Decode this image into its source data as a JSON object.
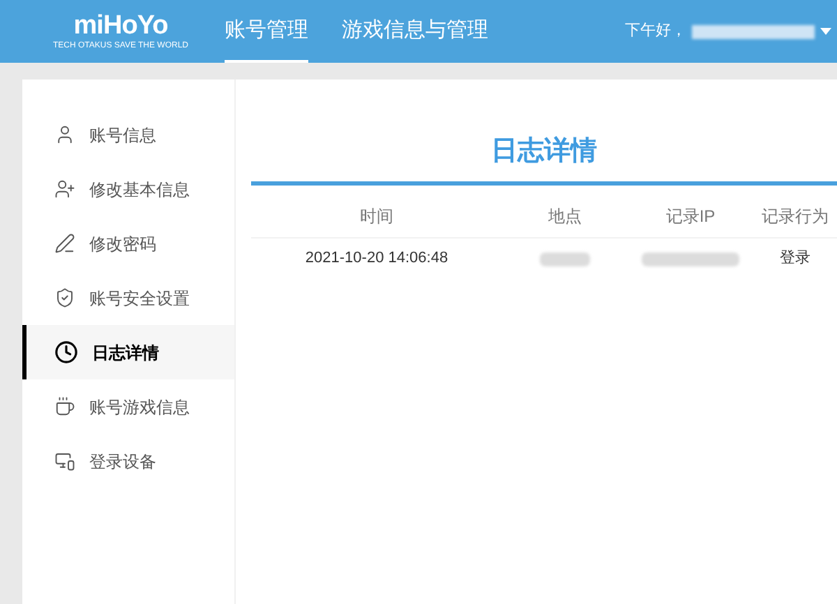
{
  "header": {
    "logo": "miHoYo",
    "logo_tagline": "TECH OTAKUS SAVE THE WORLD",
    "nav": [
      {
        "label": "账号管理",
        "selected": true
      },
      {
        "label": "游戏信息与管理",
        "selected": false
      }
    ],
    "greeting": "下午好，"
  },
  "sidebar": {
    "items": [
      {
        "kind": "user",
        "label": "账号信息",
        "selected": false
      },
      {
        "kind": "user-plus",
        "label": "修改基本信息",
        "selected": false
      },
      {
        "kind": "pen",
        "label": "修改密码",
        "selected": false
      },
      {
        "kind": "shield",
        "label": "账号安全设置",
        "selected": false
      },
      {
        "kind": "clock",
        "label": "日志详情",
        "selected": true
      },
      {
        "kind": "cup",
        "label": "账号游戏信息",
        "selected": false
      },
      {
        "kind": "devices",
        "label": "登录设备",
        "selected": false
      }
    ]
  },
  "content": {
    "title": "日志详情",
    "table": {
      "columns": [
        "时间",
        "地点",
        "记录IP",
        "记录行为"
      ],
      "rows": [
        {
          "time": "2021-10-20 14:06:48",
          "action": "登录"
        }
      ]
    }
  }
}
